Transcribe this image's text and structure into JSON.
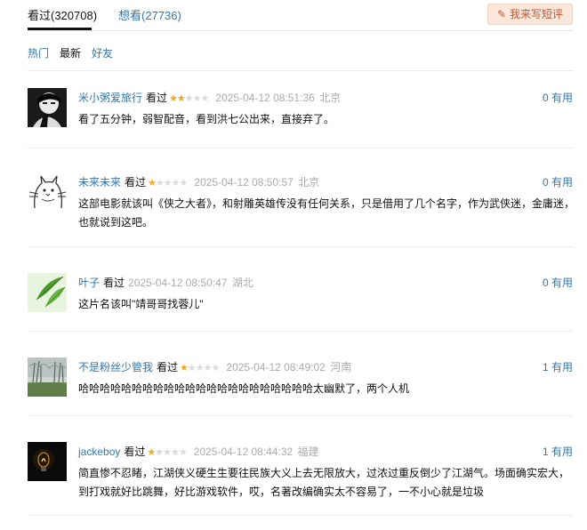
{
  "tabs": {
    "seen_label": "看过(320708)",
    "want_label": "想看(27736)"
  },
  "write_button": {
    "label": "我来写短评",
    "icon": "pencil-icon"
  },
  "sort": {
    "hot": "热门",
    "latest": "最新",
    "friends": "好友"
  },
  "colors": {
    "link": "#3377aa",
    "star_on": "#f5a623",
    "star_off": "#d9d9d9",
    "muted": "#aaaaaa",
    "button_bg": "#fbe6dc"
  },
  "comments": [
    {
      "user": "米小粥爱旅行",
      "status": "看过",
      "rating": 2,
      "time": "2025-04-12 08:51:36",
      "location": "北京",
      "votes": "0",
      "votes_label": "有用",
      "text": "看了五分钟，弱智配音，看到洪七公出来，直接弃了。"
    },
    {
      "user": "未来未来",
      "status": "看过",
      "rating": 1,
      "time": "2025-04-12 08:50:57",
      "location": "北京",
      "votes": "0",
      "votes_label": "有用",
      "text": "这部电影就该叫《侠之大者》，和射雕英雄传没有任何关系，只是借用了几个名字，作为武侠迷，金庸迷，也就说到这吧。"
    },
    {
      "user": "叶子",
      "status": "看过",
      "rating": 0,
      "time": "2025-04-12 08:50:47",
      "location": "湖北",
      "votes": "0",
      "votes_label": "有用",
      "text": "这片名该叫\"靖哥哥找蓉儿\""
    },
    {
      "user": "不是粉丝少管我",
      "status": "看过",
      "rating": 1,
      "time": "2025-04-12 08:49:02",
      "location": "河南",
      "votes": "1",
      "votes_label": "有用",
      "text": "哈哈哈哈哈哈哈哈哈哈哈哈哈哈哈哈哈哈哈哈哈哈太幽默了，两个人机"
    },
    {
      "user": "jackeboy",
      "status": "看过",
      "rating": 1,
      "time": "2025-04-12 08:44:32",
      "location": "福建",
      "votes": "1",
      "votes_label": "有用",
      "text": "简直惨不忍睹，江湖侠义硬生生要往民族大义上去无限放大，过浓过重反倒少了江湖气。场面确实宏大，到打戏就好比跳舞，好比游戏软件，哎，名著改编确实太不容易了，一不小心就是垃圾"
    }
  ]
}
